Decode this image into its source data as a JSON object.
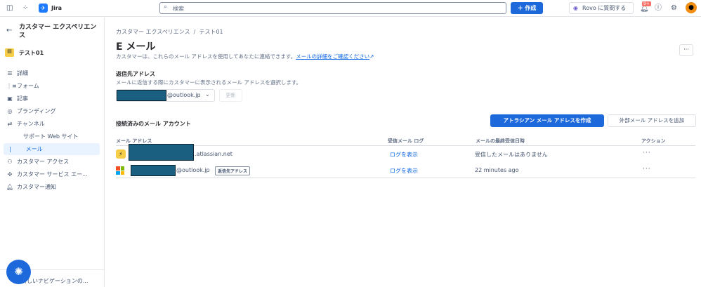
{
  "topbar": {
    "app_name": "Jira",
    "search_placeholder": "検索",
    "create_label": "作成",
    "rovo_label": "Rovo に質問する",
    "notification_badge": "9+"
  },
  "sidebar": {
    "back_title": "カスタマー エクスペリエンス",
    "project": "テスト01",
    "items": [
      {
        "label": "詳細"
      },
      {
        "label": "フォーム"
      },
      {
        "label": "記事"
      },
      {
        "label": "ブランディング"
      },
      {
        "label": "チャンネル"
      },
      {
        "label": "サポート Web サイト"
      },
      {
        "label": "メール"
      },
      {
        "label": "カスタマー アクセス"
      },
      {
        "label": "カスタマー サービス エー..."
      },
      {
        "label": "カスタマー通知"
      }
    ],
    "bottom_label": "新しいナビゲーションの..."
  },
  "main": {
    "breadcrumb": "カスタマー エクスペリエンス  /  テスト01",
    "title": "E メール",
    "description": "カスタマーは、これらのメール アドレスを使用してあなたに連絡できます。",
    "description_link": "メールの詳細をご確認ください",
    "reply": {
      "heading": "返信先アドレス",
      "subtext": "メールに返信する際にカスタマーに表示されるメール アドレスを選択します。",
      "select_value": "@outlook.jp",
      "update_label": "更新"
    },
    "accounts": {
      "heading": "接続済みのメール アカウント",
      "create_button": "アトラシアン メール アドレスを作成",
      "add_button": "外部メール アドレスを追加",
      "columns": [
        "メール アドレス",
        "受信メール ログ",
        "メールの最終受信日時",
        "アクション"
      ],
      "rows": [
        {
          "email": ".atlassian.net",
          "log": "ログを表示",
          "last": "受信したメールはありません"
        },
        {
          "email": "@outlook.jp",
          "badge": "返信先アドレス",
          "log": "ログを表示",
          "last": "22 minutes ago"
        }
      ]
    }
  }
}
